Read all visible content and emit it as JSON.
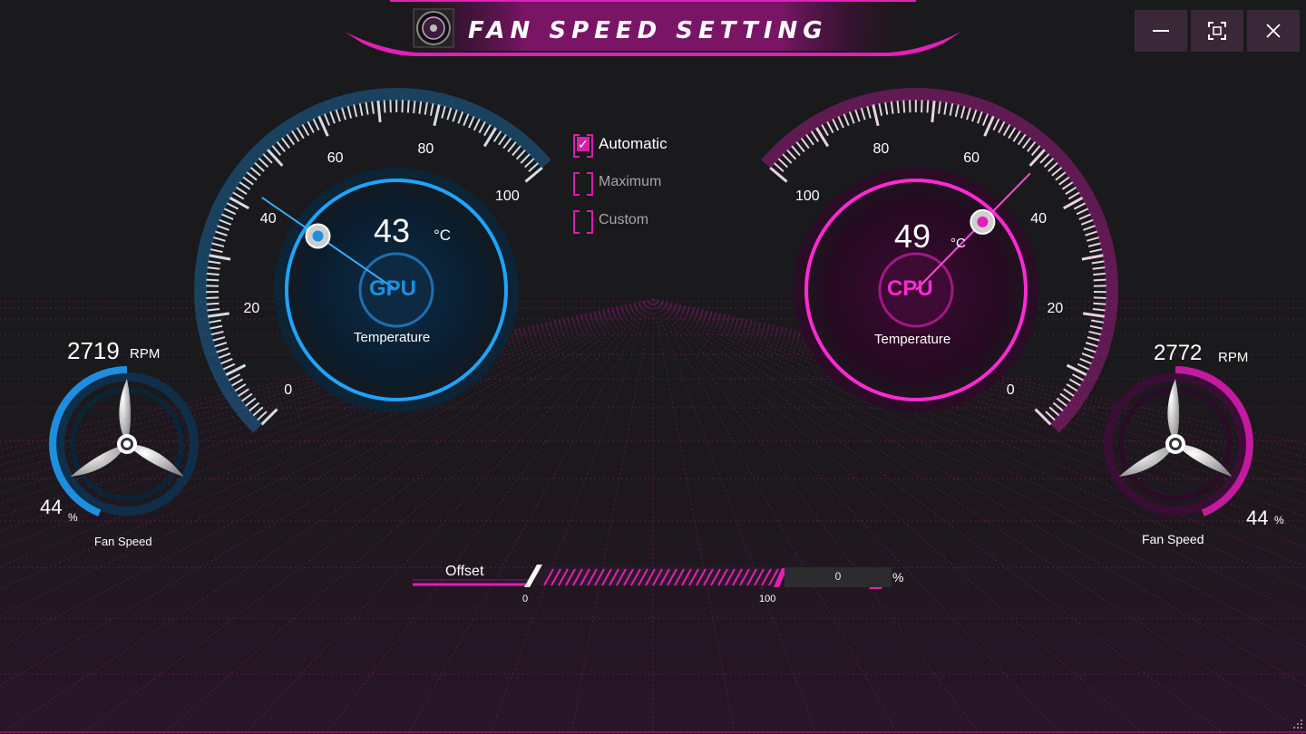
{
  "window": {
    "title": "Fan Speed Setting",
    "minimize_icon": "minimize-icon",
    "maximize_icon": "maximize-icon",
    "close_icon": "close-icon"
  },
  "gpu": {
    "label": "GPU",
    "temperature": "43",
    "temperature_unit": "°C",
    "temperature_label": "Temperature",
    "gauge_ticks": [
      "0",
      "20",
      "40",
      "60",
      "80",
      "100"
    ],
    "temperature_value": 43,
    "fan_rpm": "2719",
    "rpm_unit": "RPM",
    "fan_percent": "44",
    "fan_percent_value": 44,
    "percent_unit": "%",
    "fan_label": "Fan Speed",
    "color": "#1e8fe0"
  },
  "cpu": {
    "label": "CPU",
    "temperature": "49",
    "temperature_unit": "°C",
    "temperature_label": "Temperature",
    "gauge_ticks": [
      "0",
      "20",
      "40",
      "60",
      "80",
      "100"
    ],
    "temperature_value": 49,
    "fan_rpm": "2772",
    "rpm_unit": "RPM",
    "fan_percent": "44",
    "fan_percent_value": 44,
    "percent_unit": "%",
    "fan_label": "Fan Speed",
    "color": "#e21fb8"
  },
  "modes": [
    {
      "label": "Automatic",
      "checked": true
    },
    {
      "label": "Maximum",
      "checked": false
    },
    {
      "label": "Custom",
      "checked": false
    }
  ],
  "offset": {
    "label": "Offset",
    "min_label": "0",
    "max_label": "100",
    "value": "0",
    "unit": "%"
  },
  "colors": {
    "accent_pink": "#e21fb8",
    "accent_blue": "#1e8fe0",
    "background": "#1a191b"
  }
}
